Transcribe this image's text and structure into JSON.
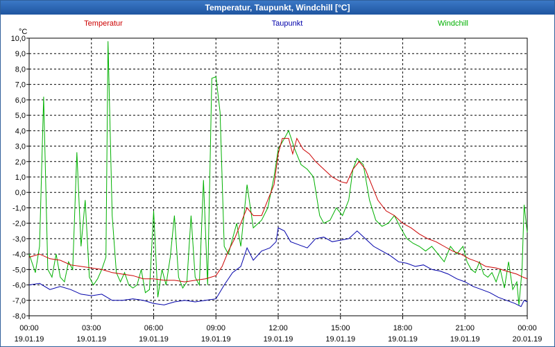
{
  "window": {
    "title": "Temperatur, Taupunkt, Windchill [°C]"
  },
  "chart_data": {
    "type": "line",
    "title": "Temperatur, Taupunkt, Windchill [°C]",
    "unit_label": "°C",
    "xlabel": "",
    "ylabel": "°C",
    "ylim": [
      -8.0,
      10.0
    ],
    "xlim_hours": [
      0,
      24
    ],
    "grid": true,
    "legend_position": "top",
    "y_ticks": [
      "10,0",
      "9,0",
      "8,0",
      "7,0",
      "6,0",
      "5,0",
      "4,0",
      "3,0",
      "2,0",
      "1,0",
      "0,0",
      "-1,0",
      "-2,0",
      "-3,0",
      "-4,0",
      "-5,0",
      "-6,0",
      "-7,0",
      "-8,0"
    ],
    "x_ticks": [
      {
        "time": "00:00",
        "date": "19.01.19"
      },
      {
        "time": "03:00",
        "date": "19.01.19"
      },
      {
        "time": "06:00",
        "date": "19.01.19"
      },
      {
        "time": "09:00",
        "date": "19.01.19"
      },
      {
        "time": "12:00",
        "date": "19.01.19"
      },
      {
        "time": "15:00",
        "date": "19.01.19"
      },
      {
        "time": "18:00",
        "date": "19.01.19"
      },
      {
        "time": "21:00",
        "date": "19.01.19"
      },
      {
        "time": "00:00",
        "date": "20.01.19"
      }
    ],
    "series": [
      {
        "name": "Temperatur",
        "color": "#cc0000",
        "points": [
          [
            0,
            -4.2
          ],
          [
            0.5,
            -4.0
          ],
          [
            1,
            -4.3
          ],
          [
            1.5,
            -4.4
          ],
          [
            2,
            -4.7
          ],
          [
            2.5,
            -4.8
          ],
          [
            3,
            -4.9
          ],
          [
            3.5,
            -5.0
          ],
          [
            4,
            -5.2
          ],
          [
            4.5,
            -5.3
          ],
          [
            5,
            -5.4
          ],
          [
            5.5,
            -5.6
          ],
          [
            6,
            -5.6
          ],
          [
            6.5,
            -5.7
          ],
          [
            7,
            -5.7
          ],
          [
            7.5,
            -5.8
          ],
          [
            8,
            -5.7
          ],
          [
            8.5,
            -5.6
          ],
          [
            9,
            -5.4
          ],
          [
            9.3,
            -4.8
          ],
          [
            9.6,
            -3.8
          ],
          [
            9.9,
            -3.0
          ],
          [
            10.2,
            -2.0
          ],
          [
            10.5,
            -1.0
          ],
          [
            10.8,
            -1.5
          ],
          [
            11.2,
            -1.5
          ],
          [
            11.5,
            -0.5
          ],
          [
            11.8,
            0.5
          ],
          [
            12.0,
            2.5
          ],
          [
            12.2,
            3.5
          ],
          [
            12.5,
            3.5
          ],
          [
            12.7,
            2.5
          ],
          [
            12.9,
            3.5
          ],
          [
            13.2,
            2.8
          ],
          [
            13.5,
            2.5
          ],
          [
            13.8,
            2.0
          ],
          [
            14.2,
            1.5
          ],
          [
            14.6,
            1.0
          ],
          [
            15.0,
            0.7
          ],
          [
            15.3,
            0.6
          ],
          [
            15.6,
            1.5
          ],
          [
            15.9,
            2.0
          ],
          [
            16.2,
            1.5
          ],
          [
            16.5,
            0.5
          ],
          [
            16.8,
            -0.5
          ],
          [
            17.2,
            -1.2
          ],
          [
            17.6,
            -1.5
          ],
          [
            18.0,
            -2.0
          ],
          [
            18.4,
            -2.3
          ],
          [
            18.8,
            -2.7
          ],
          [
            19.2,
            -3.0
          ],
          [
            19.6,
            -3.2
          ],
          [
            20.0,
            -3.5
          ],
          [
            20.4,
            -3.8
          ],
          [
            20.8,
            -4.0
          ],
          [
            21.2,
            -4.3
          ],
          [
            21.6,
            -4.5
          ],
          [
            22.0,
            -4.8
          ],
          [
            22.5,
            -4.9
          ],
          [
            23.0,
            -5.1
          ],
          [
            23.5,
            -5.3
          ],
          [
            23.8,
            -5.5
          ],
          [
            24,
            -5.6
          ]
        ]
      },
      {
        "name": "Taupunkt",
        "color": "#0000aa",
        "points": [
          [
            0,
            -6.0
          ],
          [
            0.5,
            -5.9
          ],
          [
            1,
            -6.3
          ],
          [
            1.5,
            -6.1
          ],
          [
            2,
            -6.3
          ],
          [
            2.5,
            -6.6
          ],
          [
            3,
            -6.7
          ],
          [
            3.5,
            -6.6
          ],
          [
            4,
            -7.0
          ],
          [
            4.5,
            -7.0
          ],
          [
            5,
            -6.9
          ],
          [
            5.5,
            -7.0
          ],
          [
            6,
            -7.2
          ],
          [
            6.5,
            -7.3
          ],
          [
            7,
            -7.1
          ],
          [
            7.5,
            -7.0
          ],
          [
            8,
            -7.1
          ],
          [
            8.5,
            -7.0
          ],
          [
            9,
            -6.9
          ],
          [
            9.4,
            -6.0
          ],
          [
            9.8,
            -5.2
          ],
          [
            10.2,
            -4.8
          ],
          [
            10.5,
            -3.6
          ],
          [
            10.8,
            -4.4
          ],
          [
            11.2,
            -3.8
          ],
          [
            11.6,
            -3.6
          ],
          [
            11.9,
            -3.2
          ],
          [
            12.0,
            -2.3
          ],
          [
            12.3,
            -2.5
          ],
          [
            12.6,
            -3.2
          ],
          [
            13.0,
            -3.4
          ],
          [
            13.4,
            -3.6
          ],
          [
            13.8,
            -3.0
          ],
          [
            14.2,
            -2.9
          ],
          [
            14.6,
            -3.2
          ],
          [
            15.0,
            -3.1
          ],
          [
            15.4,
            -3.0
          ],
          [
            15.8,
            -2.5
          ],
          [
            16.2,
            -3.0
          ],
          [
            16.6,
            -3.5
          ],
          [
            17.0,
            -3.8
          ],
          [
            17.4,
            -4.1
          ],
          [
            17.8,
            -4.5
          ],
          [
            18.2,
            -4.6
          ],
          [
            18.6,
            -4.8
          ],
          [
            19.0,
            -4.7
          ],
          [
            19.4,
            -5.0
          ],
          [
            19.8,
            -5.1
          ],
          [
            20.2,
            -5.3
          ],
          [
            20.6,
            -5.6
          ],
          [
            21.0,
            -5.8
          ],
          [
            21.4,
            -6.1
          ],
          [
            21.8,
            -6.3
          ],
          [
            22.2,
            -6.5
          ],
          [
            22.6,
            -6.8
          ],
          [
            23.0,
            -7.0
          ],
          [
            23.4,
            -7.2
          ],
          [
            23.7,
            -7.4
          ],
          [
            23.85,
            -7.0
          ],
          [
            24,
            -7.1
          ]
        ]
      },
      {
        "name": "Windchill",
        "color": "#00b000",
        "points": [
          [
            0,
            -4.0
          ],
          [
            0.3,
            -5.2
          ],
          [
            0.5,
            -3.5
          ],
          [
            0.7,
            6.2
          ],
          [
            0.9,
            -5.0
          ],
          [
            1.1,
            -5.5
          ],
          [
            1.3,
            -4.0
          ],
          [
            1.5,
            -5.5
          ],
          [
            1.7,
            -5.8
          ],
          [
            1.9,
            -4.5
          ],
          [
            2.1,
            -5.0
          ],
          [
            2.3,
            2.6
          ],
          [
            2.5,
            -3.5
          ],
          [
            2.7,
            -0.5
          ],
          [
            2.9,
            -5.5
          ],
          [
            3.1,
            -6.0
          ],
          [
            3.3,
            -5.6
          ],
          [
            3.5,
            -5.0
          ],
          [
            3.7,
            -4.2
          ],
          [
            3.8,
            9.8
          ],
          [
            4.0,
            -1.5
          ],
          [
            4.2,
            -5.2
          ],
          [
            4.4,
            -5.8
          ],
          [
            4.6,
            -5.2
          ],
          [
            4.8,
            -6.0
          ],
          [
            5.0,
            -6.2
          ],
          [
            5.2,
            -6.0
          ],
          [
            5.4,
            -5.0
          ],
          [
            5.6,
            -6.5
          ],
          [
            5.8,
            -6.3
          ],
          [
            6.0,
            -1.2
          ],
          [
            6.2,
            -6.8
          ],
          [
            6.4,
            -5.0
          ],
          [
            6.6,
            -6.0
          ],
          [
            6.8,
            -4.2
          ],
          [
            7.0,
            -1.5
          ],
          [
            7.2,
            -5.5
          ],
          [
            7.4,
            -6.2
          ],
          [
            7.6,
            -5.8
          ],
          [
            7.8,
            -1.5
          ],
          [
            8.0,
            -5.5
          ],
          [
            8.2,
            -6.0
          ],
          [
            8.4,
            0.8
          ],
          [
            8.6,
            -6.0
          ],
          [
            8.8,
            7.4
          ],
          [
            9.0,
            7.5
          ],
          [
            9.2,
            5.2
          ],
          [
            9.4,
            -3.5
          ],
          [
            9.6,
            -4.0
          ],
          [
            9.8,
            -3.0
          ],
          [
            10.0,
            -2.0
          ],
          [
            10.2,
            -3.5
          ],
          [
            10.5,
            0.5
          ],
          [
            10.8,
            -2.3
          ],
          [
            11.2,
            -1.8
          ],
          [
            11.5,
            -1.0
          ],
          [
            11.8,
            1.0
          ],
          [
            12.0,
            2.8
          ],
          [
            12.3,
            3.5
          ],
          [
            12.5,
            4.0
          ],
          [
            12.8,
            2.8
          ],
          [
            13.1,
            1.8
          ],
          [
            13.4,
            1.5
          ],
          [
            13.7,
            1.0
          ],
          [
            14.0,
            -1.5
          ],
          [
            14.2,
            -2.0
          ],
          [
            14.5,
            -1.8
          ],
          [
            14.8,
            -1.0
          ],
          [
            15.1,
            -1.5
          ],
          [
            15.4,
            -0.5
          ],
          [
            15.6,
            1.5
          ],
          [
            15.8,
            2.2
          ],
          [
            16.1,
            1.8
          ],
          [
            16.4,
            -0.5
          ],
          [
            16.7,
            -1.8
          ],
          [
            17.0,
            -2.2
          ],
          [
            17.3,
            -2.0
          ],
          [
            17.6,
            -1.5
          ],
          [
            17.9,
            -2.3
          ],
          [
            18.2,
            -3.0
          ],
          [
            18.5,
            -3.3
          ],
          [
            18.8,
            -3.5
          ],
          [
            19.1,
            -3.8
          ],
          [
            19.4,
            -3.5
          ],
          [
            19.7,
            -4.0
          ],
          [
            20.0,
            -4.5
          ],
          [
            20.3,
            -3.5
          ],
          [
            20.6,
            -4.0
          ],
          [
            20.9,
            -3.5
          ],
          [
            21.1,
            -4.5
          ],
          [
            21.3,
            -5.0
          ],
          [
            21.5,
            -5.2
          ],
          [
            21.7,
            -4.5
          ],
          [
            21.9,
            -5.3
          ],
          [
            22.1,
            -5.5
          ],
          [
            22.3,
            -5.2
          ],
          [
            22.5,
            -5.8
          ],
          [
            22.7,
            -5.0
          ],
          [
            22.9,
            -6.2
          ],
          [
            23.1,
            -4.5
          ],
          [
            23.3,
            -6.3
          ],
          [
            23.5,
            -5.8
          ],
          [
            23.6,
            -7.3
          ],
          [
            23.75,
            -5.0
          ],
          [
            23.85,
            -0.8
          ],
          [
            24,
            -2.6
          ]
        ]
      }
    ]
  }
}
